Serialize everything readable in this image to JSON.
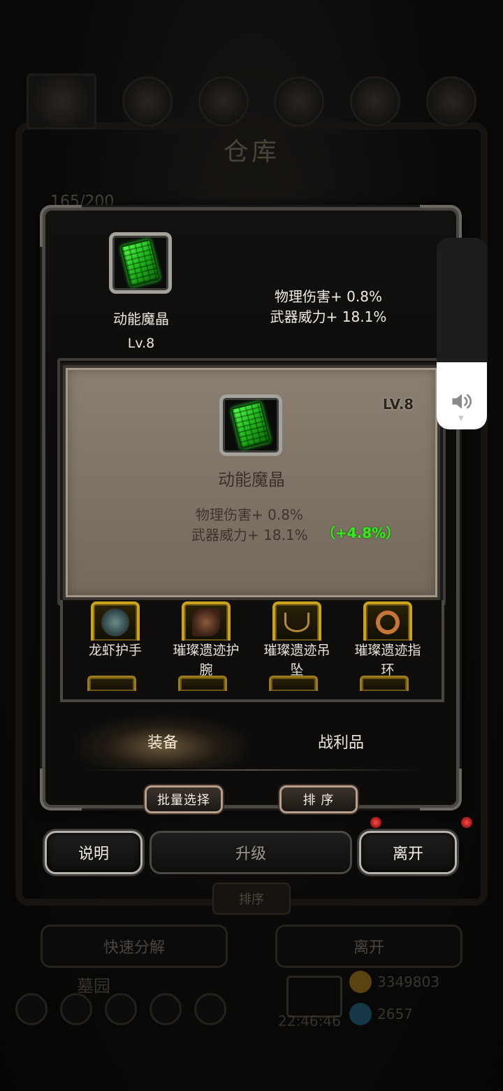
{
  "background": {
    "title": "仓库",
    "capacity": "165/200",
    "sort_label": "排序",
    "quick_decompose_label": "快速分解",
    "leave_label": "离开",
    "area_label": "墓园",
    "clock": "22:46:46",
    "gold": "3349803",
    "gems": "2657"
  },
  "current_item": {
    "name": "动能魔晶",
    "level": "Lv.8",
    "stat_1": "物理伤害+ 0.8%",
    "stat_2": "武器威力+ 18.1%"
  },
  "compare_item": {
    "name": "动能魔晶",
    "level": "LV.8",
    "stat_1": "物理伤害+ 0.8%",
    "stat_2": "武器威力+ 18.1%",
    "bonus": "（+4.8%）",
    "bonus_color": "#32f016"
  },
  "grid_items": [
    {
      "label": "龙虾护手",
      "icon": "gauntlet-icon"
    },
    {
      "label": "璀璨遗迹护腕",
      "icon": "bracer-icon"
    },
    {
      "label": "璀璨遗迹吊坠",
      "icon": "pendant-icon"
    },
    {
      "label": "璀璨遗迹指环",
      "icon": "ring-icon"
    }
  ],
  "tabs": {
    "equip": "装备",
    "loot": "战利品"
  },
  "toolbar": {
    "batch_select": "批量选择",
    "sort": "排 序"
  },
  "actions": {
    "help": "说明",
    "upgrade": "升级",
    "leave": "离开"
  },
  "volume": {
    "icon": "speaker-icon",
    "level": 0.35
  }
}
